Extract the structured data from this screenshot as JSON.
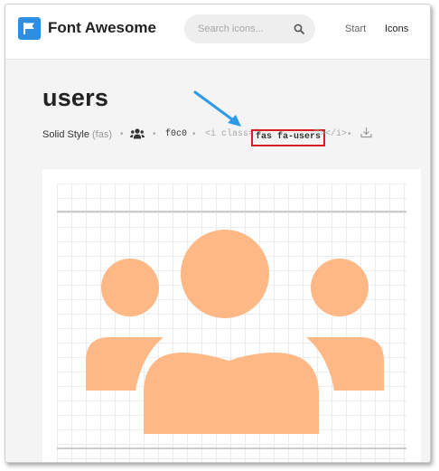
{
  "header": {
    "brand": "Font Awesome",
    "search_placeholder": "Search icons...",
    "nav": {
      "start": "Start",
      "icons": "Icons"
    }
  },
  "page": {
    "title": "users",
    "meta": {
      "style_label": "Solid Style",
      "style_prefix": "(fas)",
      "separator": "•",
      "unicode": "f0c0",
      "code_open": "<i class=\"",
      "class_name": "fas fa-users",
      "code_close": "\"></i>"
    }
  },
  "colors": {
    "brand_blue": "#2f8ee0",
    "icon_fill": "#fdb886",
    "highlight_border": "#d61f1f",
    "annotation_arrow": "#2b9be8"
  },
  "icons": [
    "flag-icon",
    "search-icon",
    "users-icon",
    "download-icon",
    "annotation-arrow"
  ]
}
